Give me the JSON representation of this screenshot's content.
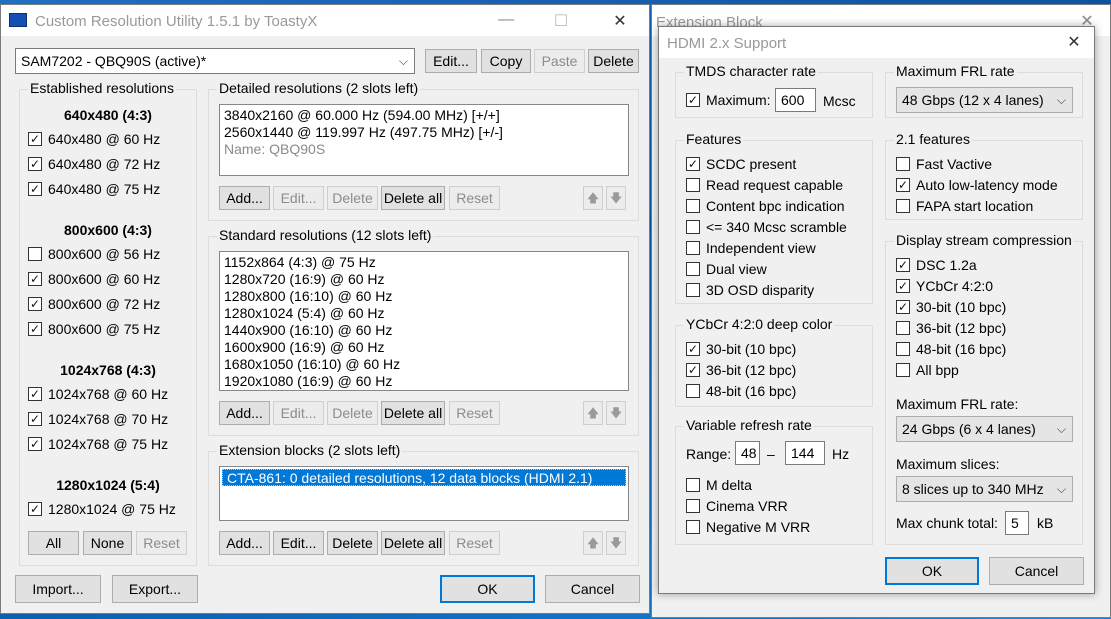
{
  "main_window": {
    "title": "Custom Resolution Utility 1.5.1 by ToastyX",
    "monitor_select": "SAM7202 - QBQ90S (active)*",
    "top_buttons": {
      "edit": "Edit...",
      "copy": "Copy",
      "paste": "Paste",
      "delete": "Delete"
    },
    "established": {
      "title": "Established resolutions",
      "groups": [
        {
          "heading": "640x480 (4:3)",
          "items": [
            {
              "label": "640x480 @ 60 Hz",
              "checked": true
            },
            {
              "label": "640x480 @ 72 Hz",
              "checked": true
            },
            {
              "label": "640x480 @ 75 Hz",
              "checked": true
            }
          ]
        },
        {
          "heading": "800x600 (4:3)",
          "items": [
            {
              "label": "800x600 @ 56 Hz",
              "checked": false
            },
            {
              "label": "800x600 @ 60 Hz",
              "checked": true
            },
            {
              "label": "800x600 @ 72 Hz",
              "checked": true
            },
            {
              "label": "800x600 @ 75 Hz",
              "checked": true
            }
          ]
        },
        {
          "heading": "1024x768 (4:3)",
          "items": [
            {
              "label": "1024x768 @ 60 Hz",
              "checked": true
            },
            {
              "label": "1024x768 @ 70 Hz",
              "checked": true
            },
            {
              "label": "1024x768 @ 75 Hz",
              "checked": true
            }
          ]
        },
        {
          "heading": "1280x1024 (5:4)",
          "items": [
            {
              "label": "1280x1024 @ 75 Hz",
              "checked": true
            }
          ]
        }
      ],
      "buttons": {
        "all": "All",
        "none": "None",
        "reset": "Reset"
      }
    },
    "detailed": {
      "title": "Detailed resolutions (2 slots left)",
      "rows": [
        "3840x2160 @ 60.000 Hz (594.00 MHz) [+/+]",
        "2560x1440 @ 119.997 Hz (497.75 MHz) [+/-]"
      ],
      "name_row": "Name: QBQ90S"
    },
    "standard": {
      "title": "Standard resolutions (12 slots left)",
      "rows": [
        "1152x864 (4:3) @ 75 Hz",
        "1280x720 (16:9) @ 60 Hz",
        "1280x800 (16:10) @ 60 Hz",
        "1280x1024 (5:4) @ 60 Hz",
        "1440x900 (16:10) @ 60 Hz",
        "1600x900 (16:9) @ 60 Hz",
        "1680x1050 (16:10) @ 60 Hz",
        "1920x1080 (16:9) @ 60 Hz"
      ]
    },
    "extension": {
      "title": "Extension blocks (2 slots left)",
      "rows": [
        "CTA-861: 0 detailed resolutions, 12 data blocks (HDMI 2.1)"
      ]
    },
    "list_buttons": {
      "add": "Add...",
      "edit": "Edit...",
      "delete": "Delete",
      "delete_all": "Delete all",
      "reset": "Reset",
      "up": "🡅",
      "down": "🡇"
    },
    "bottom": {
      "import": "Import...",
      "export": "Export...",
      "ok": "OK",
      "cancel": "Cancel"
    }
  },
  "ext_window": {
    "title": "Extension Block"
  },
  "hdmi_dialog": {
    "title": "HDMI 2.x Support",
    "tmds": {
      "title": "TMDS character rate",
      "maximum_label": "Maximum:",
      "maximum_checked": true,
      "value": "600",
      "unit": "Mcsc"
    },
    "features": {
      "title": "Features",
      "items": [
        {
          "label": "SCDC present",
          "checked": true
        },
        {
          "label": "Read request capable",
          "checked": false
        },
        {
          "label": "Content bpc indication",
          "checked": false
        },
        {
          "label": "<= 340 Mcsc scramble",
          "checked": false
        },
        {
          "label": "Independent view",
          "checked": false
        },
        {
          "label": "Dual view",
          "checked": false
        },
        {
          "label": "3D OSD disparity",
          "checked": false
        }
      ]
    },
    "ycbcr": {
      "title": "YCbCr 4:2:0 deep color",
      "items": [
        {
          "label": "30-bit (10 bpc)",
          "checked": true
        },
        {
          "label": "36-bit (12 bpc)",
          "checked": true
        },
        {
          "label": "48-bit (16 bpc)",
          "checked": false
        }
      ]
    },
    "vrr": {
      "title": "Variable refresh rate",
      "range_label": "Range:",
      "min": "48",
      "dash": "–",
      "max": "144",
      "unit": "Hz",
      "items": [
        {
          "label": "M delta",
          "checked": false
        },
        {
          "label": "Cinema VRR",
          "checked": false
        },
        {
          "label": "Negative M VRR",
          "checked": false
        }
      ]
    },
    "frl": {
      "title": "Maximum FRL rate",
      "value": "48 Gbps (12 x 4 lanes)"
    },
    "f21": {
      "title": "2.1 features",
      "items": [
        {
          "label": "Fast Vactive",
          "checked": false
        },
        {
          "label": "Auto low-latency mode",
          "checked": true
        },
        {
          "label": "FAPA start location",
          "checked": false
        }
      ]
    },
    "dsc": {
      "title": "Display stream compression",
      "items": [
        {
          "label": "DSC 1.2a",
          "checked": true
        },
        {
          "label": "YCbCr 4:2:0",
          "checked": true
        },
        {
          "label": "30-bit (10 bpc)",
          "checked": true
        },
        {
          "label": "36-bit (12 bpc)",
          "checked": false
        },
        {
          "label": "48-bit (16 bpc)",
          "checked": false
        },
        {
          "label": "All bpp",
          "checked": false
        }
      ],
      "frl_label": "Maximum FRL rate:",
      "frl_value": "24 Gbps (6 x 4 lanes)",
      "slices_label": "Maximum slices:",
      "slices_value": "8 slices up to 340 MHz",
      "chunk_label": "Max chunk total:",
      "chunk_value": "5",
      "chunk_unit": "kB"
    },
    "buttons": {
      "ok": "OK",
      "cancel": "Cancel"
    }
  },
  "icons": {
    "app": "monitor-icon",
    "close": "close-icon",
    "minimize": "minimize-icon",
    "maximize": "maximize-icon"
  },
  "colors": {
    "accent": "#0078d7",
    "selection": "#0078d7",
    "desktop": "#0b4f9c"
  }
}
